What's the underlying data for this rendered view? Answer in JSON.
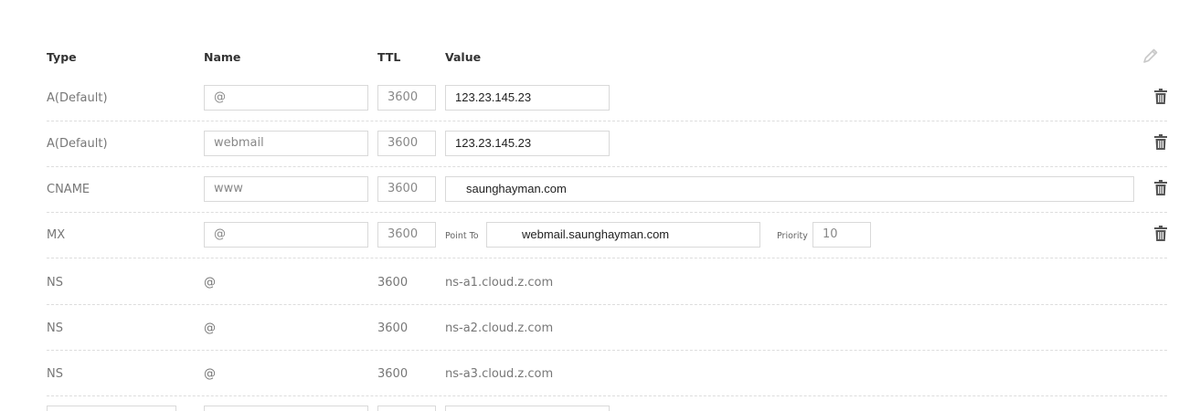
{
  "headers": {
    "type": "Type",
    "name": "Name",
    "ttl": "TTL",
    "value": "Value"
  },
  "icons": {
    "edit": "pencil-icon",
    "delete": "trash-icon"
  },
  "records": [
    {
      "type": "A(Default)",
      "name": "@",
      "ttl": "3600",
      "value": "123.23.145.23"
    },
    {
      "type": "A(Default)",
      "name": "webmail",
      "ttl": "3600",
      "value": "123.23.145.23"
    },
    {
      "type": "CNAME",
      "name": "www",
      "ttl": "3600",
      "value": "saunghayman.com"
    },
    {
      "type": "MX",
      "name": "@",
      "ttl": "3600",
      "point_to_label": "Point To",
      "point_to": "webmail.saunghayman.com",
      "priority_label": "Priority",
      "priority": "10"
    },
    {
      "type": "NS",
      "name": "@",
      "ttl": "3600",
      "value": "ns-a1.cloud.z.com"
    },
    {
      "type": "NS",
      "name": "@",
      "ttl": "3600",
      "value": "ns-a2.cloud.z.com"
    },
    {
      "type": "NS",
      "name": "@",
      "ttl": "3600",
      "value": "ns-a3.cloud.z.com"
    }
  ]
}
